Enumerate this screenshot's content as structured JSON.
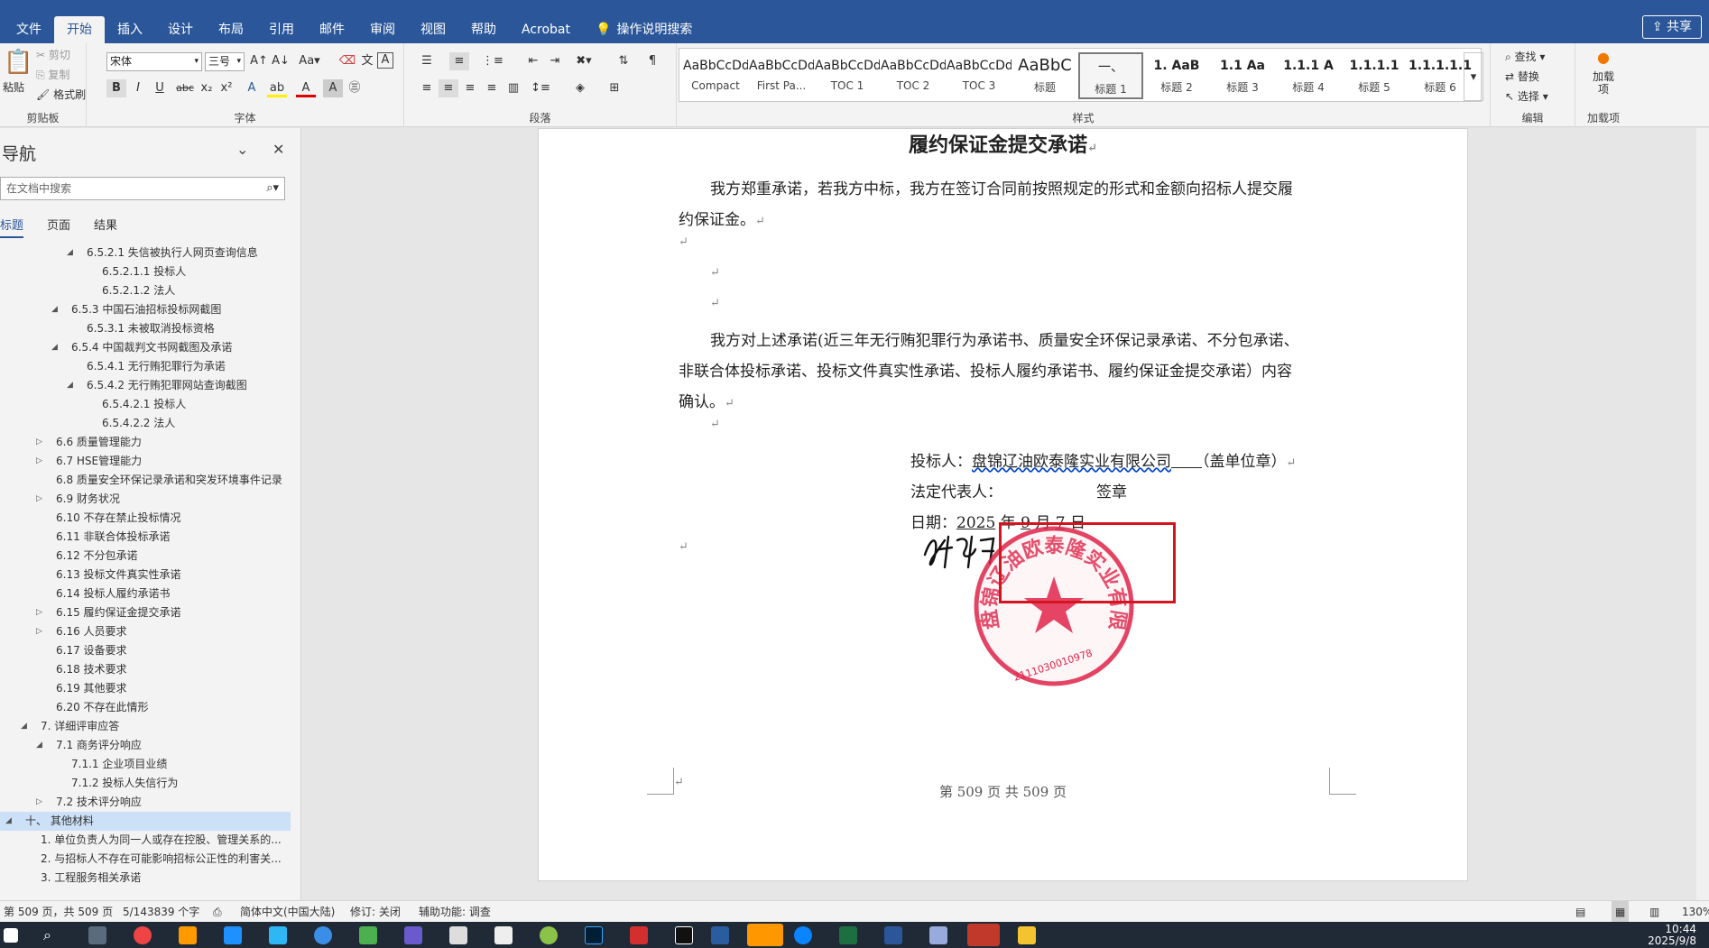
{
  "window": {
    "title": "欧泰隆-投标文件-9.8月.docx [兼容模式] - Word"
  },
  "ribbon_tabs": [
    "文件",
    "开始",
    "插入",
    "设计",
    "布局",
    "引用",
    "邮件",
    "审阅",
    "视图",
    "帮助",
    "Acrobat",
    "操作说明搜索"
  ],
  "share_label": "共享",
  "clipboard": {
    "paste": "粘贴",
    "cut": "剪切",
    "copy": "复制",
    "format_painter": "格式刷",
    "label": "剪贴板"
  },
  "font": {
    "name": "宋体",
    "size": "三号",
    "label": "字体"
  },
  "paragraph": {
    "label": "段落"
  },
  "styles": {
    "label": "样式",
    "items": [
      {
        "preview": "AaBbCcDd",
        "name": "Compact"
      },
      {
        "preview": "AaBbCcDd",
        "name": "First Pa..."
      },
      {
        "preview": "AaBbCcDd",
        "name": "TOC 1"
      },
      {
        "preview": "AaBbCcDd",
        "name": "TOC 2"
      },
      {
        "preview": "AaBbCcDd",
        "name": "TOC 3"
      },
      {
        "preview": "AaBbC",
        "name": "标题"
      },
      {
        "preview": "一、",
        "name": "标题 1"
      },
      {
        "preview": "1. AaB",
        "name": "标题 2"
      },
      {
        "preview": "1.1 Aa",
        "name": "标题 3"
      },
      {
        "preview": "1.1.1 A",
        "name": "标题 4"
      },
      {
        "preview": "1.1.1.1",
        "name": "标题 5"
      },
      {
        "preview": "1.1.1.1.1",
        "name": "标题 6"
      }
    ]
  },
  "editing": {
    "find": "查找",
    "replace": "替换",
    "select": "选择",
    "label": "编辑"
  },
  "addins": {
    "btn": "加载项",
    "label": "加载项"
  },
  "nav": {
    "title": "导航",
    "search_placeholder": "在文档中搜索",
    "tabs": [
      "标题",
      "页面",
      "结果"
    ],
    "items": [
      {
        "text": "6.5.2.1 失信被执行人网页查询信息",
        "level": 4,
        "arrow": "open"
      },
      {
        "text": "6.5.2.1.1 投标人",
        "level": 5,
        "arrow": ""
      },
      {
        "text": "6.5.2.1.2 法人",
        "level": 5,
        "arrow": ""
      },
      {
        "text": "6.5.3 中国石油招标投标网截图",
        "level": 3,
        "arrow": "open"
      },
      {
        "text": "6.5.3.1 未被取消投标资格",
        "level": 4,
        "arrow": ""
      },
      {
        "text": "6.5.4 中国裁判文书网截图及承诺",
        "level": 3,
        "arrow": "open"
      },
      {
        "text": "6.5.4.1 无行贿犯罪行为承诺",
        "level": 4,
        "arrow": ""
      },
      {
        "text": "6.5.4.2 无行贿犯罪网站查询截图",
        "level": 4,
        "arrow": "open"
      },
      {
        "text": "6.5.4.2.1 投标人",
        "level": 5,
        "arrow": ""
      },
      {
        "text": "6.5.4.2.2 法人",
        "level": 5,
        "arrow": ""
      },
      {
        "text": "6.6 质量管理能力",
        "level": 2,
        "arrow": "closed"
      },
      {
        "text": "6.7 HSE管理能力",
        "level": 2,
        "arrow": "closed"
      },
      {
        "text": "6.8 质量安全环保记录承诺和突发环境事件记录",
        "level": 2,
        "arrow": ""
      },
      {
        "text": "6.9 财务状况",
        "level": 2,
        "arrow": "closed"
      },
      {
        "text": "6.10 不存在禁止投标情况",
        "level": 2,
        "arrow": ""
      },
      {
        "text": "6.11 非联合体投标承诺",
        "level": 2,
        "arrow": ""
      },
      {
        "text": "6.12 不分包承诺",
        "level": 2,
        "arrow": ""
      },
      {
        "text": "6.13 投标文件真实性承诺",
        "level": 2,
        "arrow": ""
      },
      {
        "text": "6.14 投标人履约承诺书",
        "level": 2,
        "arrow": ""
      },
      {
        "text": "6.15 履约保证金提交承诺",
        "level": 2,
        "arrow": "closed"
      },
      {
        "text": "6.16 人员要求",
        "level": 2,
        "arrow": "closed"
      },
      {
        "text": "6.17 设备要求",
        "level": 2,
        "arrow": ""
      },
      {
        "text": "6.18 技术要求",
        "level": 2,
        "arrow": ""
      },
      {
        "text": "6.19 其他要求",
        "level": 2,
        "arrow": ""
      },
      {
        "text": "6.20 不存在此情形",
        "level": 2,
        "arrow": ""
      },
      {
        "text": "7. 详细评审应答",
        "level": 1,
        "arrow": "open"
      },
      {
        "text": "7.1 商务评分响应",
        "level": 2,
        "arrow": "open"
      },
      {
        "text": "7.1.1 企业项目业绩",
        "level": 3,
        "arrow": ""
      },
      {
        "text": "7.1.2 投标人失信行为",
        "level": 3,
        "arrow": ""
      },
      {
        "text": "7.2 技术评分响应",
        "level": 2,
        "arrow": "closed"
      },
      {
        "text": "十、 其他材料",
        "level": 0,
        "arrow": "open",
        "selected": true
      },
      {
        "text": "1. 单位负责人为同一人或存在控股、管理关系的...",
        "level": 1,
        "arrow": ""
      },
      {
        "text": "2. 与招标人不存在可能影响招标公正性的利害关...",
        "level": 1,
        "arrow": ""
      },
      {
        "text": "3. 工程服务相关承诺",
        "level": 1,
        "arrow": ""
      }
    ]
  },
  "document": {
    "title": "履约保证金提交承诺",
    "para1_line1": "我方郑重承诺，若我方中标，我方在签订合同前按照规定的形式和金额向招标人提交履",
    "para1_line2": "约保证金。",
    "para2_line1": "我方对上述承诺(近三年无行贿犯罪行为承诺书、质量安全环保记录承诺、不分包承诺、",
    "para2_line2": "非联合体投标承诺、投标文件真实性承诺、投标人履约承诺书、履约保证金提交承诺）内容",
    "para2_line3": "确认。",
    "bidder_label": "投标人：",
    "bidder_name": "盘锦辽油欧泰隆实业有限公司",
    "bidder_suffix": "（盖单位章）",
    "rep_label": "法定代表人：",
    "rep_suffix": "签章",
    "date_label": "日期：",
    "date_year": "2025",
    "date_y": "年",
    "date_month": "9",
    "date_m": "月",
    "date_day": "7",
    "date_d": "日",
    "seal_text": "盘锦辽油欧泰隆实业有限公司",
    "seal_number": "2111030010978",
    "footer": "第 509 页 共 509 页"
  },
  "status": {
    "page": "第 509 页，共 509 页",
    "words": "5/143839 个字",
    "language": "简体中文(中国大陆)",
    "track": "修订: 关闭",
    "accessibility": "辅助功能: 调查",
    "zoom": "130%"
  },
  "clock": {
    "time": "10:44",
    "date": "2025/9/8"
  }
}
